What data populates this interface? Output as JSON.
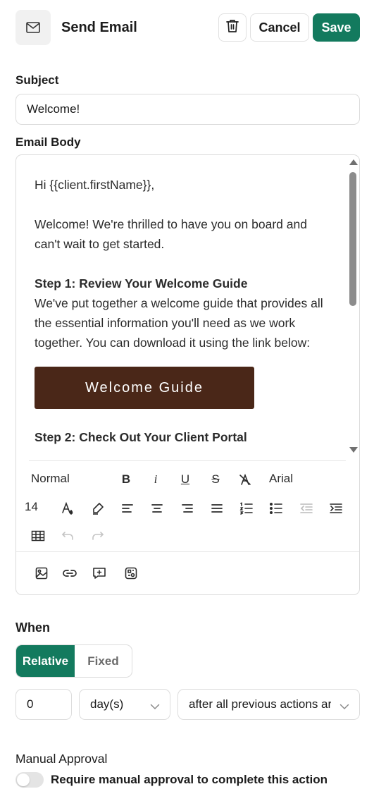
{
  "header": {
    "title": "Send Email",
    "icon": "mail-icon",
    "delete_icon": "trash-icon",
    "cancel_label": "Cancel",
    "save_label": "Save",
    "accent_color": "#137a5e"
  },
  "subject": {
    "label": "Subject",
    "value": "Welcome!"
  },
  "email_body": {
    "label": "Email Body",
    "greeting": "Hi {{client.firstName}},",
    "intro": "Welcome! We're thrilled to have you on board and can't wait to get started.",
    "step1_title": "Step 1: Review Your Welcome Guide",
    "step1_text": "We've put together a welcome guide that provides all the essential information you'll need as we work together. You can download it using the link below:",
    "button_label": "Welcome Guide",
    "button_color": "#4a2718",
    "step2_title": "Step 2: Check Out Your Client Portal"
  },
  "toolbar": {
    "style": "Normal",
    "font": "Arial",
    "font_size": "14",
    "buttons": [
      "bold-icon",
      "italic-icon",
      "underline-icon",
      "strikethrough-icon",
      "clear-format-icon",
      "text-color-icon",
      "highlight-icon",
      "align-left-icon",
      "align-center-icon",
      "align-right-icon",
      "align-justify-icon",
      "ordered-list-icon",
      "bullet-list-icon",
      "outdent-icon",
      "indent-icon",
      "table-icon",
      "undo-icon",
      "redo-icon"
    ],
    "insert_buttons": [
      "image-icon",
      "link-icon",
      "add-comment-icon",
      "variable-icon"
    ]
  },
  "when": {
    "label": "When",
    "mode_relative": "Relative",
    "mode_fixed": "Fixed",
    "selected_mode": "Relative",
    "amount": "0",
    "unit": "day(s)",
    "relation": "after all previous actions are completed"
  },
  "approval": {
    "label": "Manual Approval",
    "toggle_label": "Require manual approval to complete this action",
    "enabled": false
  }
}
